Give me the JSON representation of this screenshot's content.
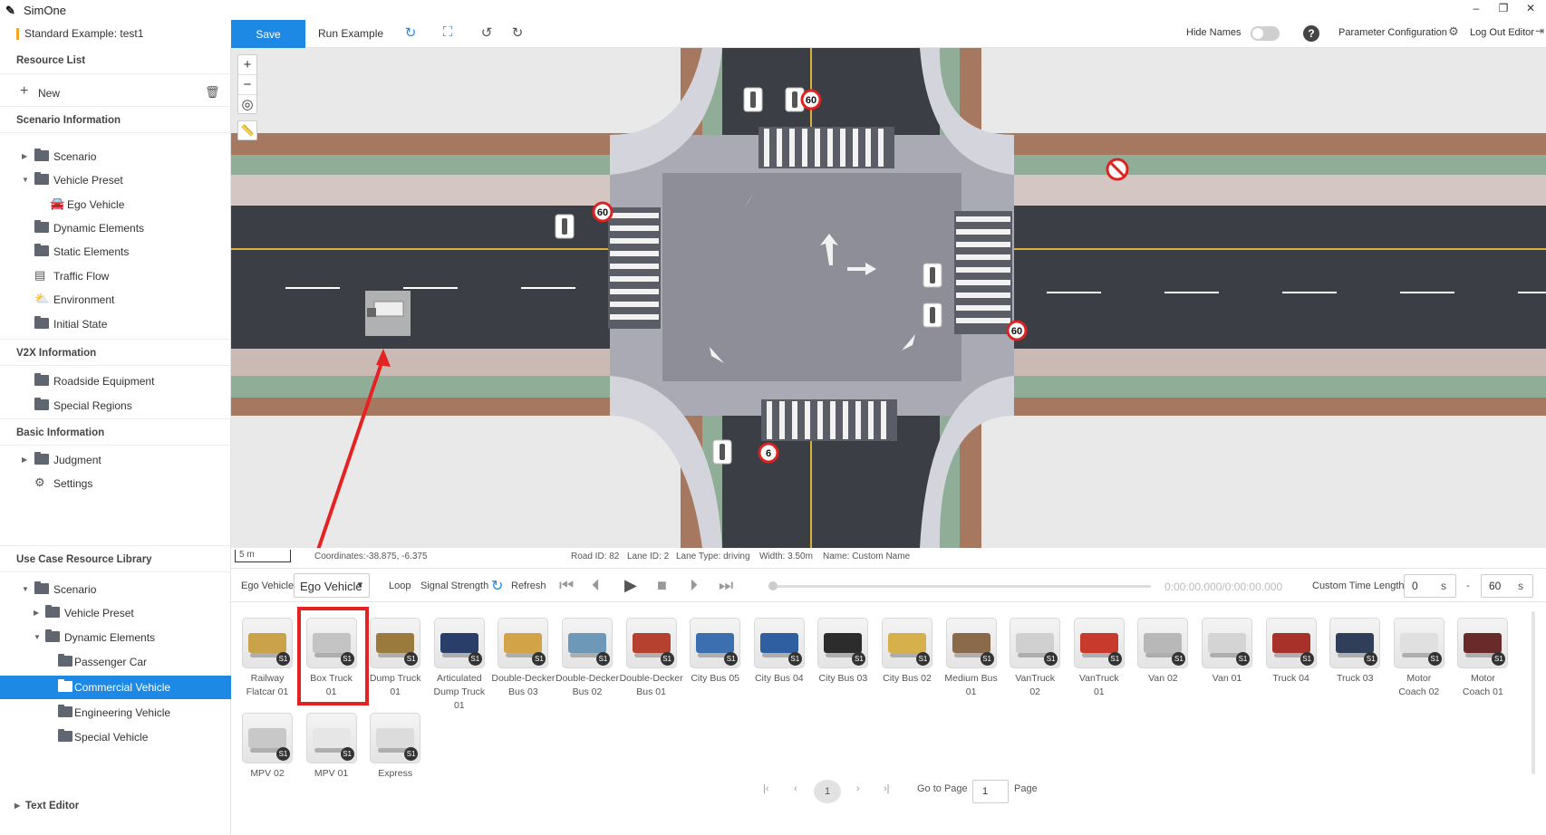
{
  "app": {
    "title": "SimOne",
    "project": "Standard Example: test1"
  },
  "window_controls": [
    "–",
    "❐",
    "✕"
  ],
  "toolbar": {
    "save": "Save",
    "run": "Run Example",
    "hide_names": "Hide Names",
    "param_config": "Parameter Configuration",
    "logout": "Log Out Editor"
  },
  "sidebar": {
    "resource_list": "Resource List",
    "new": "New",
    "scenario_info": "Scenario Information",
    "scenario_items": [
      "Scenario",
      "Vehicle Preset",
      "Ego Vehicle",
      "Dynamic Elements",
      "Static Elements",
      "Traffic Flow",
      "Environment",
      "Initial State"
    ],
    "v2x_info": "V2X Information",
    "v2x_items": [
      "Roadside Equipment",
      "Special Regions"
    ],
    "basic_info": "Basic Information",
    "basic_items": [
      "Judgment",
      "Settings"
    ],
    "use_case_lib": "Use Case Resource Library",
    "lib_items": [
      "Scenario",
      "Vehicle Preset",
      "Dynamic Elements",
      "Passenger Car",
      "Commercial Vehicle",
      "Engineering Vehicle",
      "Special Vehicle"
    ],
    "text_editor": "Text Editor"
  },
  "map": {
    "zoom_in": "+",
    "zoom_out": "−",
    "signs": [
      "60",
      "60",
      "60",
      "6"
    ]
  },
  "status": {
    "scale": "5 m",
    "coords": "Coordinates:-38.875, -6.375",
    "road_id": "Road ID: 82",
    "lane_id": "Lane ID: 2",
    "lane_type": "Lane Type: driving",
    "width": "Width: 3.50m",
    "name": "Name: Custom Name"
  },
  "controls": {
    "ego_label": "Ego Vehicle",
    "ego_select": "Ego Vehicle",
    "loop": "Loop",
    "signal": "Signal Strength",
    "refresh": "Refresh",
    "time": "0:00:00.000/0:00:00.000",
    "custom_time": "Custom Time Length",
    "start_val": "0",
    "end_val": "60",
    "unit": "s",
    "dash": "-"
  },
  "vehicles": [
    {
      "l1": "Railway",
      "l2": "Flatcar 01",
      "l3": "",
      "color": "#caa24a"
    },
    {
      "l1": "Box Truck",
      "l2": "01",
      "l3": "",
      "color": "#c4c4c4"
    },
    {
      "l1": "Dump Truck",
      "l2": "01",
      "l3": "",
      "color": "#9b7a3e"
    },
    {
      "l1": "Articulated",
      "l2": "Dump Truck",
      "l3": "01",
      "color": "#2a3e6a"
    },
    {
      "l1": "Double-Decker",
      "l2": "Bus 03",
      "l3": "",
      "color": "#d2a347"
    },
    {
      "l1": "Double-Decker",
      "l2": "Bus 02",
      "l3": "",
      "color": "#6d98b8"
    },
    {
      "l1": "Double-Decker",
      "l2": "Bus 01",
      "l3": "",
      "color": "#b7412f"
    },
    {
      "l1": "City Bus 05",
      "l2": "",
      "l3": "",
      "color": "#3b6fb0"
    },
    {
      "l1": "City Bus 04",
      "l2": "",
      "l3": "",
      "color": "#2f5fa0"
    },
    {
      "l1": "City Bus 03",
      "l2": "",
      "l3": "",
      "color": "#2c2c2c"
    },
    {
      "l1": "City Bus 02",
      "l2": "",
      "l3": "",
      "color": "#d6b04a"
    },
    {
      "l1": "Medium Bus",
      "l2": "01",
      "l3": "",
      "color": "#8a6a4a"
    },
    {
      "l1": "VanTruck",
      "l2": "02",
      "l3": "",
      "color": "#d0d0d0"
    },
    {
      "l1": "VanTruck",
      "l2": "01",
      "l3": "",
      "color": "#c83a2c"
    },
    {
      "l1": "Van 02",
      "l2": "",
      "l3": "",
      "color": "#b8b8b8"
    },
    {
      "l1": "Van 01",
      "l2": "",
      "l3": "",
      "color": "#d4d4d4"
    },
    {
      "l1": "Truck 04",
      "l2": "",
      "l3": "",
      "color": "#a8322a"
    },
    {
      "l1": "Truck 03",
      "l2": "",
      "l3": "",
      "color": "#2f3f5a"
    },
    {
      "l1": "Motor",
      "l2": "Coach 02",
      "l3": "",
      "color": "#e0e0e0"
    },
    {
      "l1": "Motor",
      "l2": "Coach 01",
      "l3": "",
      "color": "#6a2a2a"
    },
    {
      "l1": "MPV 02",
      "l2": "",
      "l3": "",
      "color": "#c8c8c8"
    },
    {
      "l1": "MPV 01",
      "l2": "",
      "l3": "",
      "color": "#e6e6e6"
    },
    {
      "l1": "Express",
      "l2": "",
      "l3": "",
      "color": "#dcdcdc"
    }
  ],
  "badge": "S1",
  "pager": {
    "current": "1",
    "goto": "Go to Page",
    "value": "1",
    "page": "Page"
  }
}
